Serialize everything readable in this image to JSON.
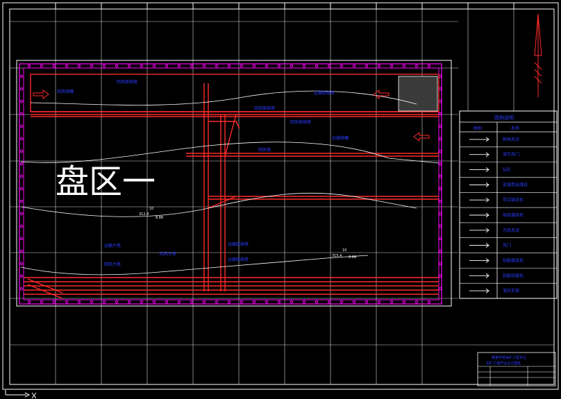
{
  "drawing": {
    "big_title": "盘区一",
    "colors": {
      "background": "#000000",
      "frame": "#ffffff",
      "grid": "#ffffff",
      "panel_boundary": "#ff00ff",
      "roadway": "#ff2a2a",
      "text": "#2a3cff",
      "contour": "#ffffff"
    },
    "roadway_labels": [
      "回风顺槽",
      "回风联络巷",
      "运输联络巷",
      "回风联络巷",
      "回风联络巷",
      "运输顺槽",
      "回风巷",
      "运输大巷",
      "回风大巷",
      "运输联络巷",
      "回风大巷",
      "运输联络巷"
    ],
    "elevation_labels": [
      {
        "code": "10",
        "elev": "312.4",
        "value": "8.86"
      },
      {
        "code": "10",
        "elev": "315.4",
        "value": "8.86"
      }
    ]
  },
  "legend": {
    "title": "图例说明",
    "col_symbol": "图例",
    "col_name": "名称",
    "items": [
      {
        "icon": "airflow-arrow-icon",
        "label": "新鲜风流"
      },
      {
        "icon": "regulator-icon",
        "label": "调节风门"
      },
      {
        "icon": "borehole-icon",
        "label": "钻孔"
      },
      {
        "icon": "shearer-icon",
        "label": "双滚筒采煤机"
      },
      {
        "icon": "conveyor-icon",
        "label": "带式输送机"
      },
      {
        "icon": "fan-icon",
        "label": "局部通风机"
      },
      {
        "icon": "return-air-icon",
        "label": "污风风流"
      },
      {
        "icon": "air-door-icon",
        "label": "风门"
      },
      {
        "icon": "scraper-conveyor-icon",
        "label": "刮板输送机"
      },
      {
        "icon": "loader-icon",
        "label": "刮板转载机"
      },
      {
        "icon": "hydraulic-support-icon",
        "label": "液压支架"
      }
    ]
  },
  "title_block": {
    "line1": "某某学院采矿工程专业",
    "line2": "采矿工程毕业设计图纸"
  }
}
